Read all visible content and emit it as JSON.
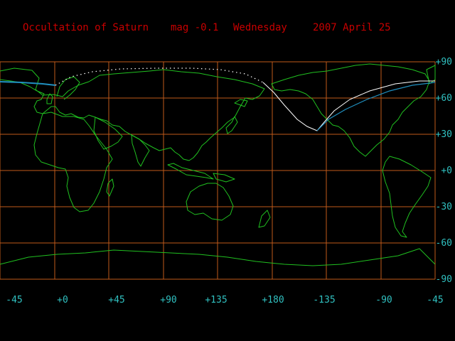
{
  "header": {
    "title": "Occultation of Saturn",
    "magnitude": "mag -0.1",
    "weekday": "Wednesday",
    "date": "2007 April 25"
  },
  "lat_labels": [
    "+90",
    "+60",
    "+30",
    "+0",
    "-30",
    "-60",
    "-90"
  ],
  "lon_labels": [
    "-45",
    "+0",
    "+45",
    "+90",
    "+135",
    "+180",
    "-135",
    "-90",
    "-45"
  ],
  "colors": {
    "background": "#000000",
    "grid": "#c05a1a",
    "coastline": "#20c020",
    "title_text": "#c80000",
    "axis_text": "#30c0c0",
    "daylight_track": "#ffffff",
    "night_track": "#2090c0"
  }
}
